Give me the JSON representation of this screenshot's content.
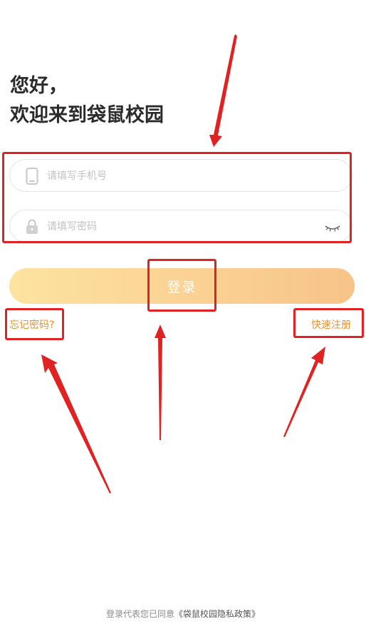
{
  "greeting": {
    "line1": "您好，",
    "line2": "欢迎来到袋鼠校园"
  },
  "form": {
    "phone_placeholder": "请填写手机号",
    "phone_icon": "phone-icon",
    "password_placeholder": "请填写密码",
    "password_icon": "lock-icon",
    "eye_icon": "eye-closed-icon"
  },
  "login_button": "登录",
  "links": {
    "forgot": "忘记密码?",
    "register": "快速注册"
  },
  "footer": {
    "prefix": "登录代表您已同意",
    "policy": "《袋鼠校园隐私政策》"
  },
  "colors": {
    "annotation_red": "#e02222",
    "button_gradient_start": "#fde3a0",
    "button_gradient_end": "#f7c389",
    "link_orange": "#e8932f"
  }
}
